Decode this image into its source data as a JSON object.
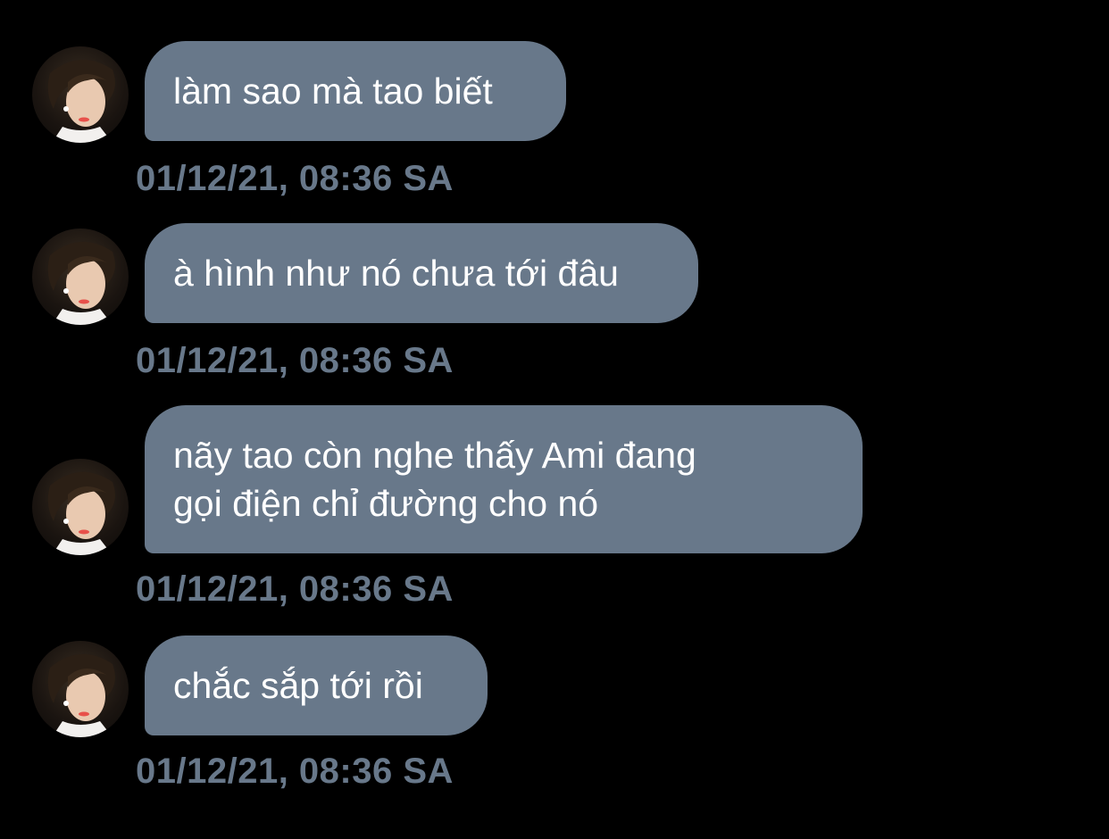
{
  "colors": {
    "background": "#000000",
    "bubble": "#68788a",
    "bubble_text": "#ffffff",
    "timestamp": "#68788a"
  },
  "messages": [
    {
      "avatar_icon": "user-avatar",
      "text": "làm sao mà tao biết",
      "timestamp": "01/12/21, 08:36 SA"
    },
    {
      "avatar_icon": "user-avatar",
      "text": "à hình như nó chưa tới đâu",
      "timestamp": "01/12/21, 08:36 SA"
    },
    {
      "avatar_icon": "user-avatar",
      "text": "nãy tao còn nghe thấy Ami đang\ngọi điện chỉ đường cho nó",
      "timestamp": "01/12/21, 08:36 SA"
    },
    {
      "avatar_icon": "user-avatar",
      "text": "chắc sắp tới rồi",
      "timestamp": "01/12/21, 08:36 SA"
    }
  ]
}
